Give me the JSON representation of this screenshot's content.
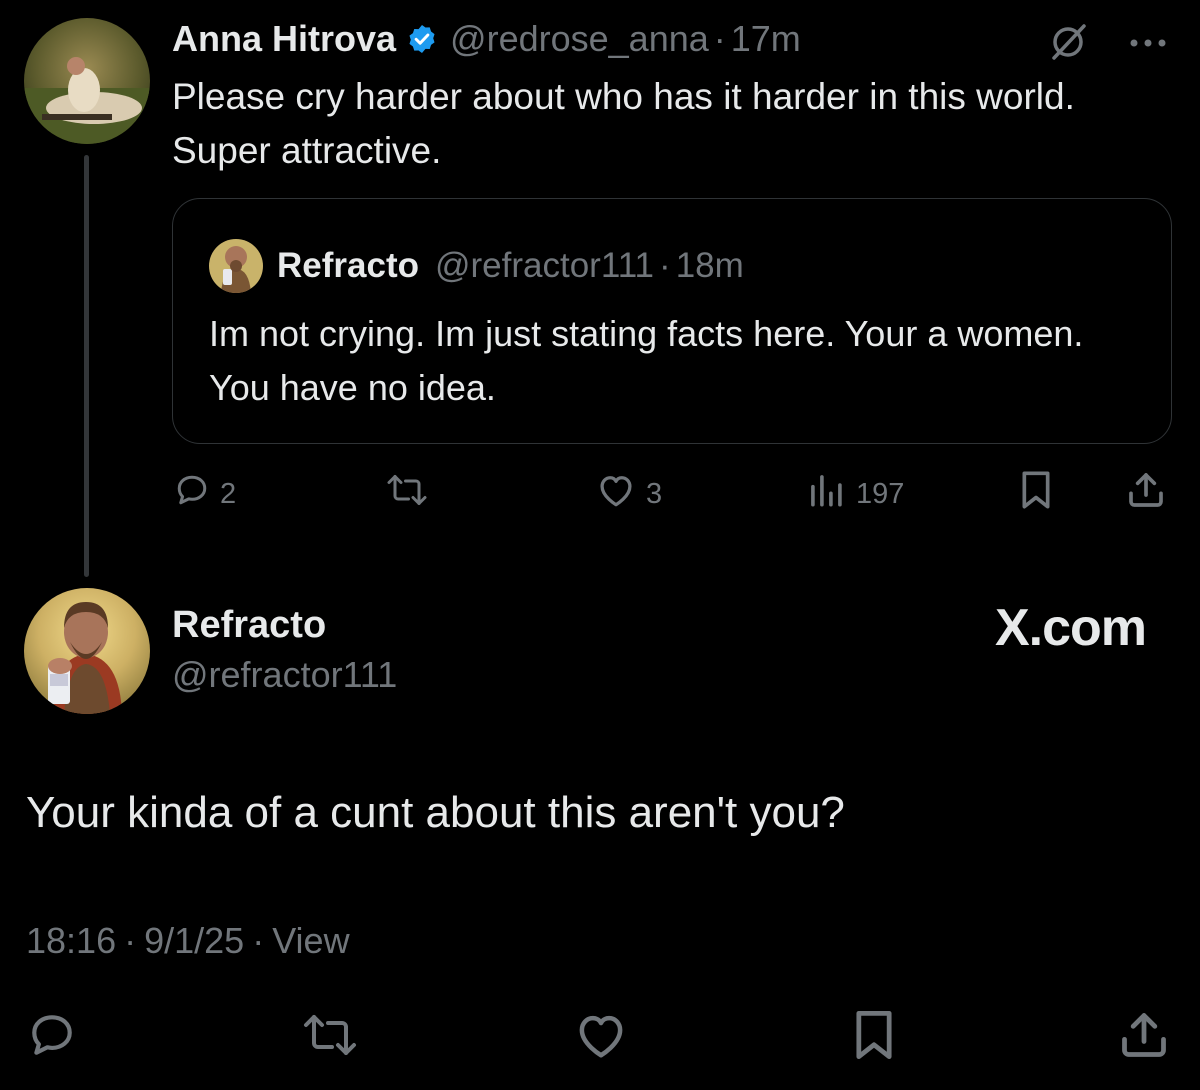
{
  "quoting_tweet": {
    "author_name": "Anna Hitrova",
    "handle": "@redrose_anna",
    "separator": "·",
    "time": "17m",
    "text": "Please cry harder about who has it harder in this world. Super attractive.",
    "verified": true,
    "quoted_tweet": {
      "author_name": "Refracto",
      "handle": "@refractor111",
      "separator": "·",
      "time": "18m",
      "text": "Im not crying. Im just stating facts here. Your a women. You have no idea."
    },
    "actions": {
      "replies": "2",
      "likes": "3",
      "views": "197"
    }
  },
  "main_tweet": {
    "author_name": "Refracto",
    "handle": "@refractor111",
    "text": "Your kinda of a cunt about this aren't you?",
    "time": "18:16",
    "date": "9/1/25",
    "separator": "·",
    "view_label": "View"
  },
  "watermark": "X.com",
  "colors": {
    "background": "#000000",
    "text": "#e7e9ea",
    "muted": "#71767b",
    "verified": "#1d9bf0",
    "border": "#2f3336"
  },
  "icons": [
    "verified-badge-icon",
    "grok-icon",
    "more-icon",
    "reply-icon",
    "retweet-icon",
    "like-icon",
    "views-icon",
    "bookmark-icon",
    "share-icon"
  ]
}
